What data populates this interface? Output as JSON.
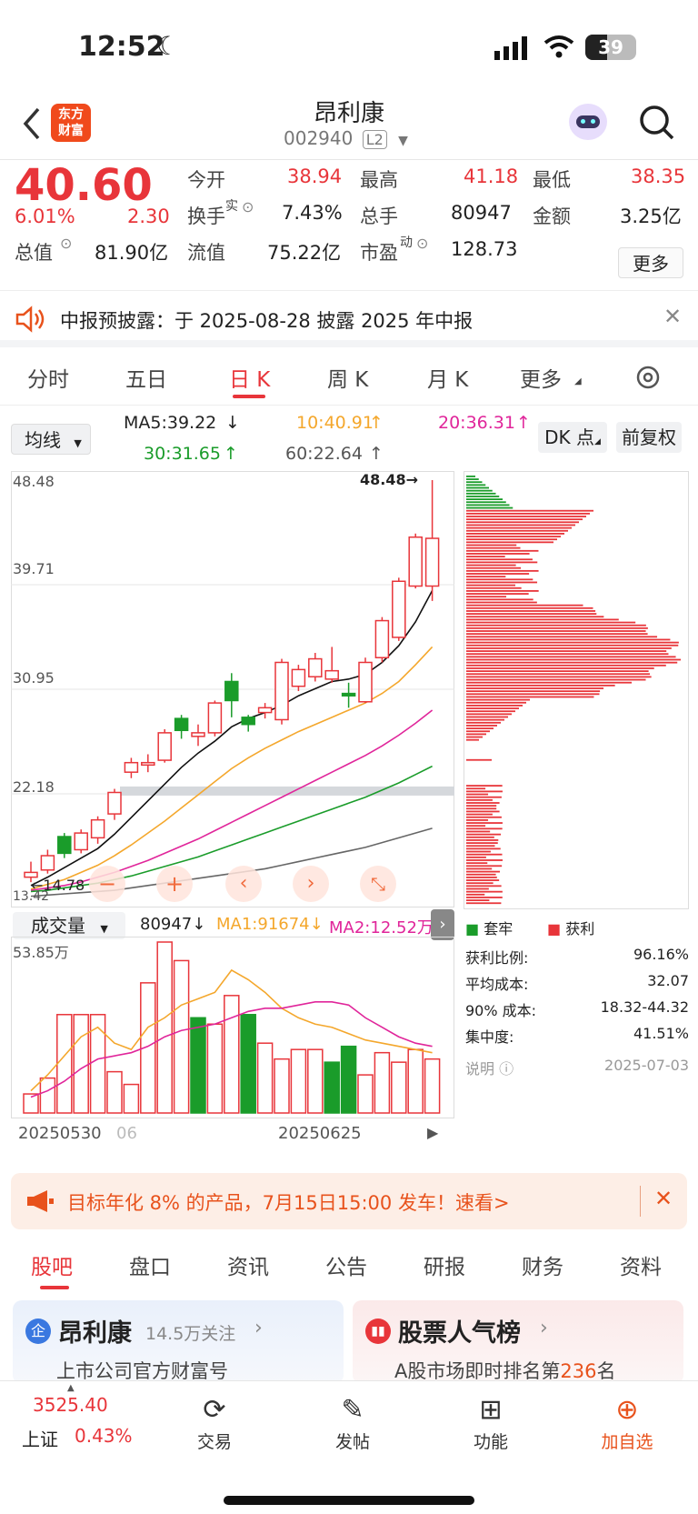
{
  "status": {
    "time": "12:52",
    "battery": "39"
  },
  "nav": {
    "logo_line1": "东方",
    "logo_line2": "财富",
    "title": "昂利康",
    "code": "002940",
    "level": "L2"
  },
  "quote": {
    "price": "40.60",
    "change_pct": "6.01%",
    "change": "2.30",
    "open_label": "今开",
    "open": "38.94",
    "high_label": "最高",
    "high": "41.18",
    "low_label": "最低",
    "low": "38.35",
    "turnover_label": "换手",
    "turnover_sup": "实",
    "turnover": "7.43%",
    "volume_label": "总手",
    "volume": "80947",
    "amount_label": "金额",
    "amount": "3.25亿",
    "mcap_label": "总值",
    "mcap": "81.90亿",
    "float_label": "流值",
    "float": "75.22亿",
    "pe_label": "市盈",
    "pe_sup": "动",
    "pe": "128.73",
    "more": "更多"
  },
  "notice": {
    "text": "中报预披露：于 2025-08-28 披露 2025 年中报"
  },
  "tabs": [
    "分时",
    "五日",
    "日 K",
    "周 K",
    "月 K",
    "更多"
  ],
  "ma": {
    "selector": "均线",
    "ma5": "MA5:39.22",
    "ma10": "10:40.91",
    "ma20": "20:36.31",
    "ma30": "30:31.65",
    "ma60": "60:22.64",
    "dk": "DK 点",
    "adjust": "前复权"
  },
  "chart_data": {
    "type": "candlestick",
    "y_ticks": [
      "48.48",
      "39.71",
      "30.95",
      "22.18",
      "13.42"
    ],
    "ylim": [
      13.42,
      48.48
    ],
    "max_label": "48.48",
    "min_label": "14.78",
    "candles": [
      {
        "o": 15.2,
        "c": 15.6,
        "h": 16.5,
        "l": 14.78,
        "up": true
      },
      {
        "o": 15.8,
        "c": 17.0,
        "h": 17.5,
        "l": 15.5,
        "up": true
      },
      {
        "o": 17.2,
        "c": 18.6,
        "h": 18.9,
        "l": 16.8,
        "up": false
      },
      {
        "o": 17.5,
        "c": 18.9,
        "h": 19.2,
        "l": 17.2,
        "up": true
      },
      {
        "o": 18.5,
        "c": 20.0,
        "h": 20.3,
        "l": 18.0,
        "up": true
      },
      {
        "o": 20.5,
        "c": 22.3,
        "h": 22.6,
        "l": 20.0,
        "up": true
      },
      {
        "o": 24.0,
        "c": 24.8,
        "h": 25.2,
        "l": 23.5,
        "up": true
      },
      {
        "o": 24.6,
        "c": 24.8,
        "h": 25.5,
        "l": 24.0,
        "up": true
      },
      {
        "o": 25.0,
        "c": 27.3,
        "h": 27.6,
        "l": 24.8,
        "up": true
      },
      {
        "o": 27.5,
        "c": 28.5,
        "h": 28.8,
        "l": 26.8,
        "up": false
      },
      {
        "o": 27.0,
        "c": 27.3,
        "h": 28.0,
        "l": 26.2,
        "up": true
      },
      {
        "o": 27.3,
        "c": 29.8,
        "h": 30.0,
        "l": 27.0,
        "up": true
      },
      {
        "o": 31.6,
        "c": 30.0,
        "h": 32.3,
        "l": 28.6,
        "up": false
      },
      {
        "o": 28.6,
        "c": 28.0,
        "h": 28.8,
        "l": 27.4,
        "up": false
      },
      {
        "o": 29.0,
        "c": 29.4,
        "h": 29.8,
        "l": 28.5,
        "up": true
      },
      {
        "o": 28.4,
        "c": 33.2,
        "h": 33.5,
        "l": 28.0,
        "up": true
      },
      {
        "o": 31.2,
        "c": 32.6,
        "h": 33.0,
        "l": 30.8,
        "up": true
      },
      {
        "o": 32.0,
        "c": 33.5,
        "h": 34.0,
        "l": 31.6,
        "up": true
      },
      {
        "o": 31.8,
        "c": 32.5,
        "h": 34.5,
        "l": 31.5,
        "up": true
      },
      {
        "o": 30.6,
        "c": 30.4,
        "h": 31.5,
        "l": 29.4,
        "up": false
      },
      {
        "o": 29.9,
        "c": 33.2,
        "h": 33.6,
        "l": 29.8,
        "up": true
      },
      {
        "o": 33.6,
        "c": 36.7,
        "h": 37.0,
        "l": 33.2,
        "up": true
      },
      {
        "o": 35.3,
        "c": 40.0,
        "h": 40.3,
        "l": 35.0,
        "up": true
      },
      {
        "o": 39.6,
        "c": 43.7,
        "h": 44.0,
        "l": 39.4,
        "up": true
      },
      {
        "o": 39.6,
        "c": 43.6,
        "h": 48.48,
        "l": 38.35,
        "up": true
      }
    ],
    "ma_series": {
      "ma5": [
        14.5,
        15.2,
        16.0,
        16.8,
        17.6,
        18.8,
        20.2,
        21.6,
        23.0,
        24.4,
        25.6,
        26.6,
        27.8,
        28.5,
        29.0,
        29.6,
        30.4,
        31.0,
        31.6,
        31.8,
        32.2,
        33.2,
        34.6,
        36.6,
        39.22
      ],
      "ma10": [
        14.2,
        14.6,
        15.0,
        15.6,
        16.2,
        17.0,
        17.9,
        18.9,
        19.9,
        21.0,
        22.1,
        23.2,
        24.3,
        25.2,
        26.0,
        26.7,
        27.4,
        28.0,
        28.6,
        29.2,
        29.8,
        30.6,
        31.6,
        33.0,
        34.5
      ],
      "ma20": [
        14.1,
        14.3,
        14.5,
        14.8,
        15.2,
        15.6,
        16.1,
        16.6,
        17.2,
        17.8,
        18.4,
        19.1,
        19.8,
        20.5,
        21.2,
        21.9,
        22.6,
        23.3,
        24.0,
        24.7,
        25.4,
        26.2,
        27.1,
        28.1,
        29.2
      ],
      "ma30": [
        14.0,
        14.1,
        14.3,
        14.5,
        14.7,
        15.0,
        15.3,
        15.7,
        16.1,
        16.5,
        16.9,
        17.4,
        17.9,
        18.4,
        18.9,
        19.4,
        19.9,
        20.4,
        20.9,
        21.4,
        21.9,
        22.5,
        23.1,
        23.8,
        24.5
      ],
      "ma60": [
        13.6,
        13.7,
        13.8,
        13.9,
        14.0,
        14.1,
        14.3,
        14.5,
        14.7,
        14.9,
        15.1,
        15.3,
        15.5,
        15.7,
        15.9,
        16.2,
        16.5,
        16.8,
        17.1,
        17.4,
        17.7,
        18.1,
        18.5,
        18.9,
        19.3
      ]
    },
    "volume_label": "成交量",
    "volume_value": "80947",
    "vol_ma1": "MA1:91674",
    "vol_ma2": "MA2:12.52万",
    "vol_max": "53.85万",
    "volumes": [
      6,
      11,
      31,
      31,
      31,
      13,
      9,
      41,
      53.85,
      48,
      30,
      28,
      37,
      31,
      22,
      17,
      20,
      20,
      16,
      21,
      12,
      19,
      16,
      20,
      17
    ],
    "vol_up": [
      true,
      true,
      true,
      true,
      true,
      true,
      true,
      true,
      true,
      true,
      false,
      true,
      true,
      false,
      true,
      true,
      true,
      true,
      false,
      false,
      true,
      true,
      true,
      true,
      true
    ],
    "vol_ma1_series": [
      7,
      12,
      18,
      24,
      27,
      22,
      20,
      27,
      30,
      34,
      36,
      38,
      45,
      42,
      38,
      33,
      30,
      28,
      27,
      25,
      23,
      22,
      21,
      20,
      19
    ],
    "vol_ma2_series": [
      5,
      7,
      10,
      14,
      17,
      18,
      19,
      21,
      24,
      26,
      27,
      28,
      30,
      32,
      33,
      33,
      34,
      35,
      35,
      34,
      30,
      27,
      24,
      22,
      21
    ],
    "dates": [
      "20250530",
      "06",
      "20250625"
    ]
  },
  "chips": {
    "legend_trapped": "套牢",
    "legend_profit": "获利",
    "profit_ratio_label": "获利比例:",
    "profit_ratio": "96.16%",
    "avg_cost_label": "平均成本:",
    "avg_cost": "32.07",
    "cost90_label": "90% 成本:",
    "cost90": "18.32-44.32",
    "concentration_label": "集中度:",
    "concentration": "41.51%",
    "explain_label": "说明",
    "date": "2025-07-03"
  },
  "banner": {
    "text": "目标年化 8% 的产品，7月15日15:00 发车！速看>"
  },
  "bottom_tabs": [
    "股吧",
    "盘口",
    "资讯",
    "公告",
    "研报",
    "财务",
    "资料"
  ],
  "cards": {
    "left_title": "昂利康",
    "left_follow": "14.5万关注",
    "left_sub": "上市公司官方财富号",
    "right_title": "股票人气榜",
    "right_sub_prefix": "A股市场即时排名第",
    "right_rank": "236",
    "right_sub_suffix": "名"
  },
  "bottombar": {
    "index_value": "3525.40",
    "index_name": "上证",
    "index_pct": "0.43%",
    "trade": "交易",
    "post": "发帖",
    "func": "功能",
    "add": "加自选"
  },
  "colors": {
    "up": "#e8353a",
    "down": "#1a9c2a",
    "accent": "#f05a1c"
  }
}
